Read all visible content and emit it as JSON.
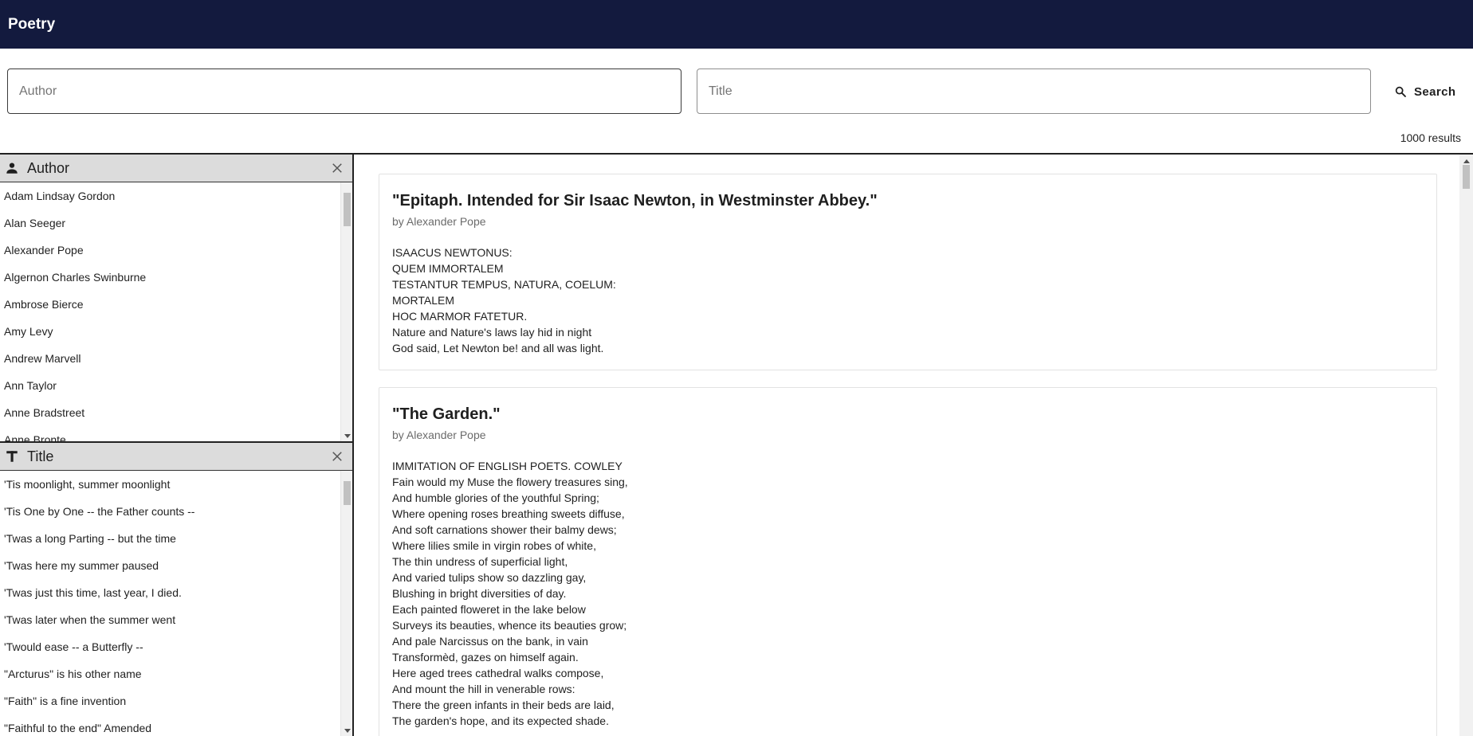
{
  "app": {
    "title": "Poetry"
  },
  "search": {
    "author_placeholder": "Author",
    "title_placeholder": "Title",
    "button_label": "Search",
    "results_count": "1000 results"
  },
  "author_facet": {
    "label": "Author",
    "items": [
      "Adam Lindsay Gordon",
      "Alan Seeger",
      "Alexander Pope",
      "Algernon Charles Swinburne",
      "Ambrose Bierce",
      "Amy Levy",
      "Andrew Marvell",
      "Ann Taylor",
      "Anne Bradstreet",
      "Anne Bronte"
    ]
  },
  "title_facet": {
    "label": "Title",
    "items": [
      "'Tis moonlight, summer moonlight",
      "'Tis One by One -- the Father counts --",
      "'Twas a long Parting -- but the time",
      "'Twas here my summer paused",
      "'Twas just this time, last year, I died.",
      "'Twas later when the summer went",
      "'Twould ease -- a Butterfly --",
      "\"Arcturus\" is his other name",
      "\"Faith\" is a fine invention",
      "\"Faithful to the end\" Amended"
    ]
  },
  "results": [
    {
      "title": "\"Epitaph. Intended for Sir Isaac Newton, in Westminster Abbey.\"",
      "author": "by Alexander Pope",
      "lines": [
        "ISAACUS NEWTONUS:",
        "QUEM IMMORTALEM",
        "TESTANTUR TEMPUS, NATURA, COELUM:",
        "MORTALEM",
        "HOC MARMOR FATETUR.",
        "Nature and Nature's laws lay hid in night",
        "God said, Let Newton be! and all was light."
      ]
    },
    {
      "title": "\"The Garden.\"",
      "author": "by Alexander Pope",
      "lines": [
        "IMMITATION OF ENGLISH POETS. COWLEY",
        "Fain would my Muse the flowery treasures sing,",
        "And humble glories of the youthful Spring;",
        "Where opening roses breathing sweets diffuse,",
        "And soft carnations shower their balmy dews;",
        "Where lilies smile in virgin robes of white,",
        "The thin undress of superficial light,",
        "And varied tulips show so dazzling gay,",
        "Blushing in bright diversities of day.",
        "Each painted floweret in the lake below",
        "Surveys its beauties, whence its beauties grow;",
        "And pale Narcissus on the bank, in vain",
        "Transformèd, gazes on himself again.",
        "Here aged trees cathedral walks compose,",
        "And mount the hill in venerable rows:",
        "There the green infants in their beds are laid,",
        "The garden's hope, and its expected shade."
      ]
    }
  ]
}
